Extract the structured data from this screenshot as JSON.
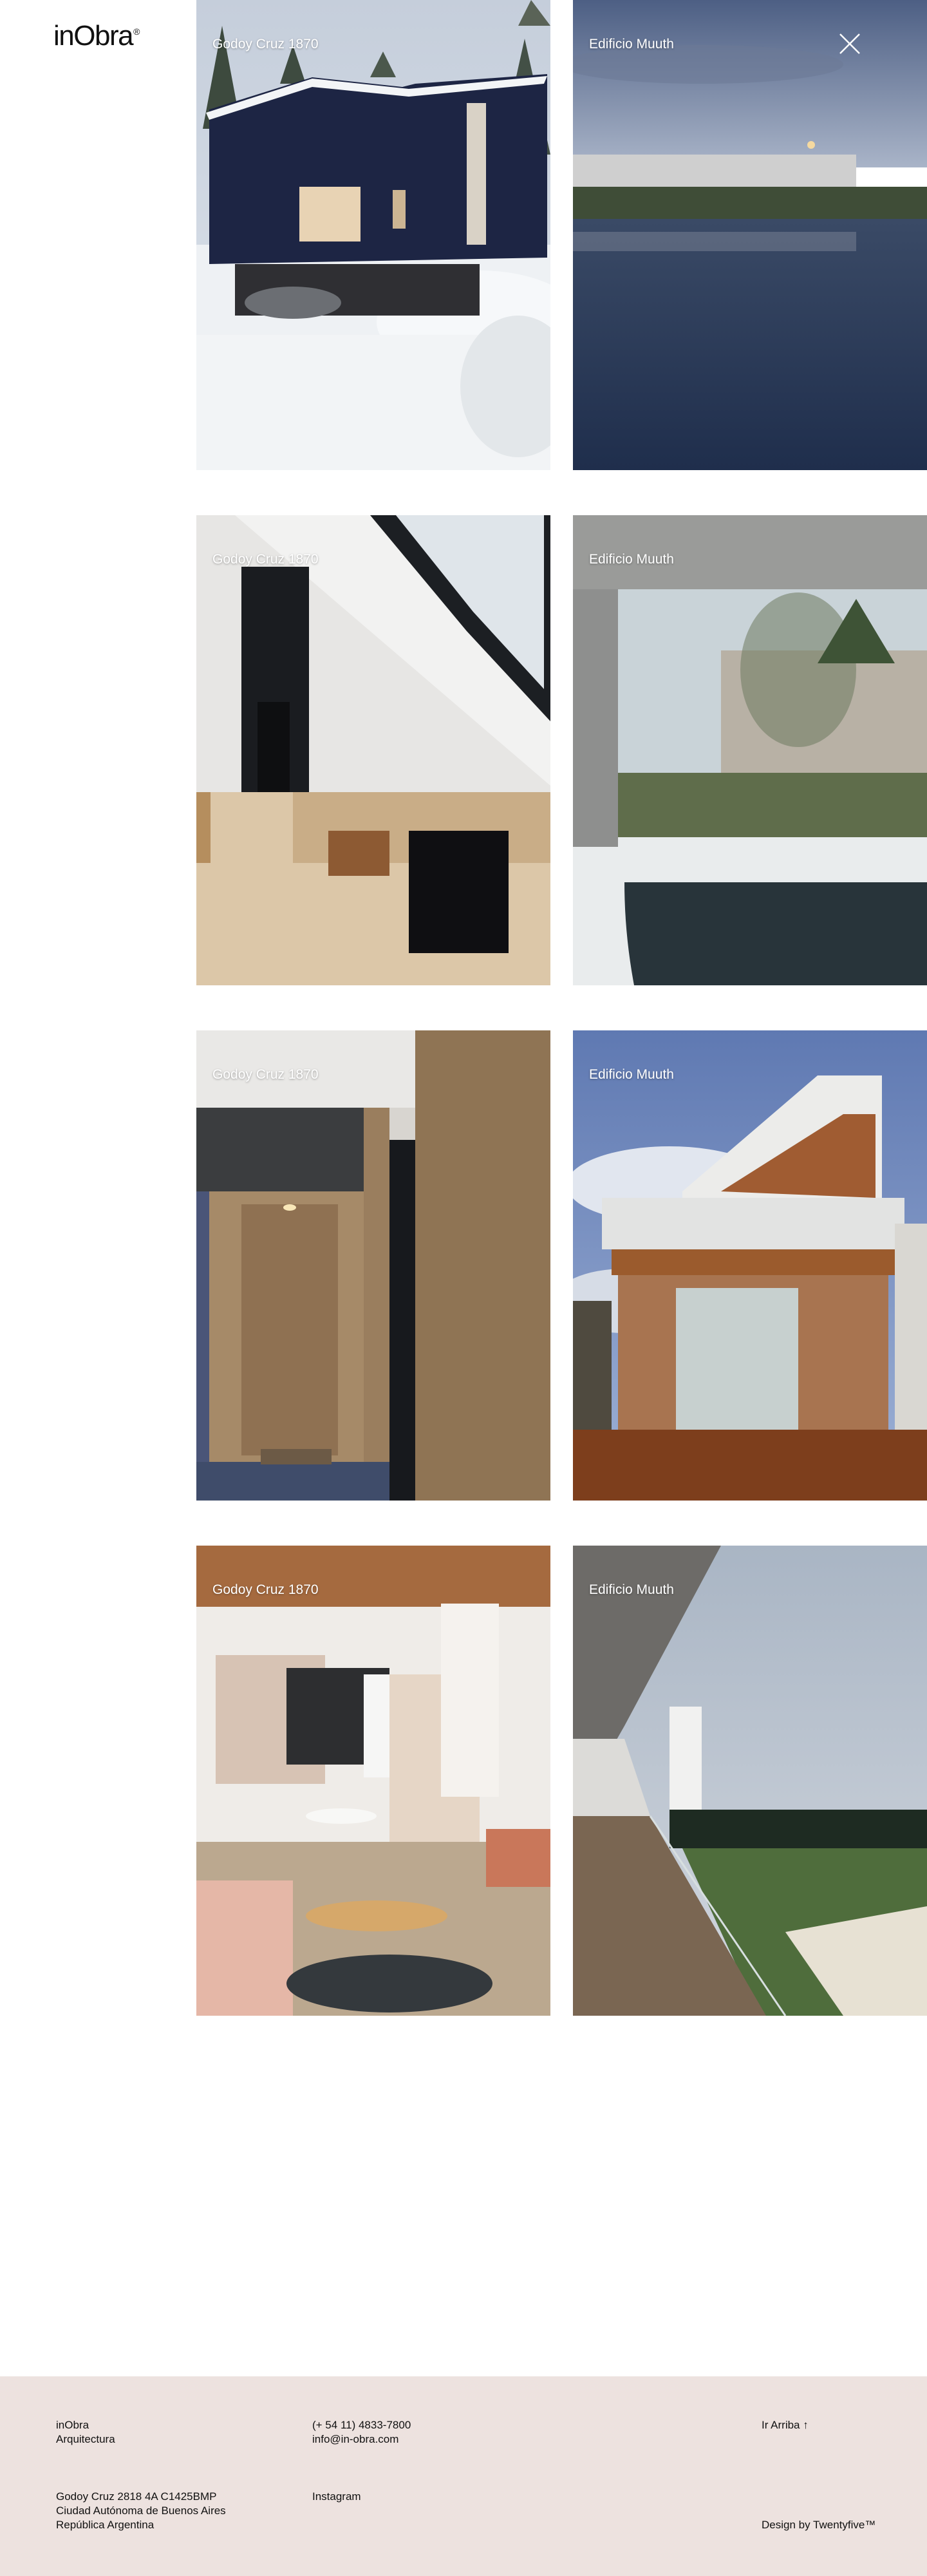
{
  "brand": {
    "logo_text": "inObra",
    "logo_mark": "®"
  },
  "header": {
    "close_icon": "close-icon"
  },
  "projects": [
    {
      "label": "Godoy Cruz 1870"
    },
    {
      "label": "Edificio Muuth"
    },
    {
      "label": "Godoy Cruz 1870"
    },
    {
      "label": "Edificio Muuth"
    },
    {
      "label": "Godoy Cruz 1870"
    },
    {
      "label": "Edificio Muuth"
    },
    {
      "label": "Godoy Cruz 1870"
    },
    {
      "label": "Edificio Muuth"
    }
  ],
  "footer": {
    "company_line1": "inObra",
    "company_line2": "Arquitectura",
    "phone": "(+ 54 11) 4833-7800",
    "email": "info@in-obra.com",
    "back_to_top": "Ir Arriba ↑",
    "address_line1": "Godoy Cruz 2818 4A C1425BMP",
    "address_line2": "Ciudad Autónoma de Buenos Aires",
    "address_line3": "República Argentina",
    "instagram": "Instagram",
    "credit": "Design by Twentyfive™"
  },
  "colors": {
    "footer_bg": "#ede2df",
    "text": "#111111"
  }
}
